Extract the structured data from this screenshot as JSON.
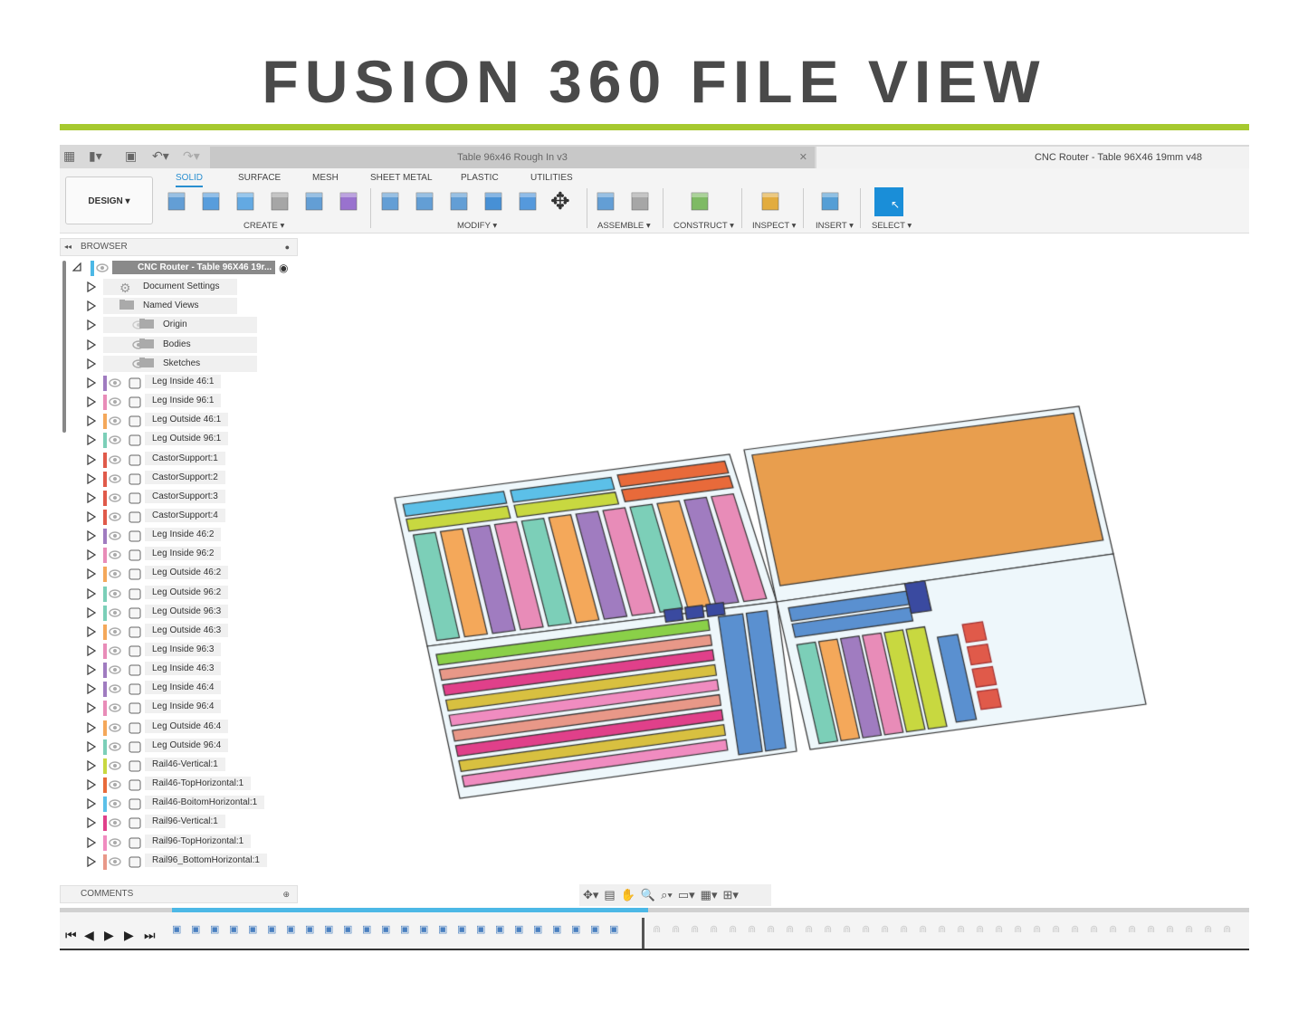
{
  "page_title": "FUSION 360 FILE VIEW",
  "accent_color": "#a6c92f",
  "app": {
    "inactive_tab": "Table 96x46 Rough In v3",
    "active_tab": "CNC Router - Table 96X46 19mm v48",
    "workspace": "DESIGN ▾",
    "ribbon_tabs": [
      "SOLID",
      "SURFACE",
      "MESH",
      "SHEET METAL",
      "PLASTIC",
      "UTILITIES"
    ],
    "groups": [
      "CREATE ▾",
      "MODIFY ▾",
      "ASSEMBLE ▾",
      "CONSTRUCT ▾",
      "INSPECT ▾",
      "INSERT ▾",
      "SELECT ▾"
    ],
    "browser_label": "BROWSER",
    "comments_label": "COMMENTS",
    "root": "CNC Router - Table 96X46 19r...",
    "folders": [
      {
        "label": "Document Settings",
        "icon": "gear-icon",
        "eye": false
      },
      {
        "label": "Named Views",
        "icon": "folder-icon",
        "eye": false
      },
      {
        "label": "Origin",
        "icon": "folder-icon",
        "eye": "hidden"
      },
      {
        "label": "Bodies",
        "icon": "folder-icon",
        "eye": true
      },
      {
        "label": "Sketches",
        "icon": "folder-icon",
        "eye": true
      }
    ],
    "components": [
      {
        "label": "Leg Inside 46:1",
        "color": "#a07cc0"
      },
      {
        "label": "Leg Inside 96:1",
        "color": "#e88cb8"
      },
      {
        "label": "Leg Outside 46:1",
        "color": "#f4a85a"
      },
      {
        "label": "Leg Outside 96:1",
        "color": "#7ccfb8"
      },
      {
        "label": "CastorSupport:1",
        "color": "#e05a4a"
      },
      {
        "label": "CastorSupport:2",
        "color": "#e05a4a"
      },
      {
        "label": "CastorSupport:3",
        "color": "#e05a4a"
      },
      {
        "label": "CastorSupport:4",
        "color": "#e05a4a"
      },
      {
        "label": "Leg Inside 46:2",
        "color": "#a07cc0"
      },
      {
        "label": "Leg Inside 96:2",
        "color": "#e88cb8"
      },
      {
        "label": "Leg Outside 46:2",
        "color": "#f4a85a"
      },
      {
        "label": "Leg Outside 96:2",
        "color": "#7ccfb8"
      },
      {
        "label": "Leg Outside 96:3",
        "color": "#7ccfb8"
      },
      {
        "label": "Leg Outside 46:3",
        "color": "#f4a85a"
      },
      {
        "label": "Leg Inside 96:3",
        "color": "#e88cb8"
      },
      {
        "label": "Leg Inside 46:3",
        "color": "#a07cc0"
      },
      {
        "label": "Leg Inside 46:4",
        "color": "#a07cc0"
      },
      {
        "label": "Leg Inside 96:4",
        "color": "#e88cb8"
      },
      {
        "label": "Leg Outside 46:4",
        "color": "#f4a85a"
      },
      {
        "label": "Leg Outside 96:4",
        "color": "#7ccfb8"
      },
      {
        "label": "Rail46-Vertical:1",
        "color": "#c8d840"
      },
      {
        "label": "Rail46-TopHorizontal:1",
        "color": "#e86a3a"
      },
      {
        "label": "Rail46-BoitomHorizontal:1",
        "color": "#5cc0e8"
      },
      {
        "label": "Rail96-Vertical:1",
        "color": "#e0408a"
      },
      {
        "label": "Rail96-TopHorizontal:1",
        "color": "#f08cc0"
      },
      {
        "label": "Rail96_BottomHorizontal:1",
        "color": "#e89888"
      }
    ]
  }
}
